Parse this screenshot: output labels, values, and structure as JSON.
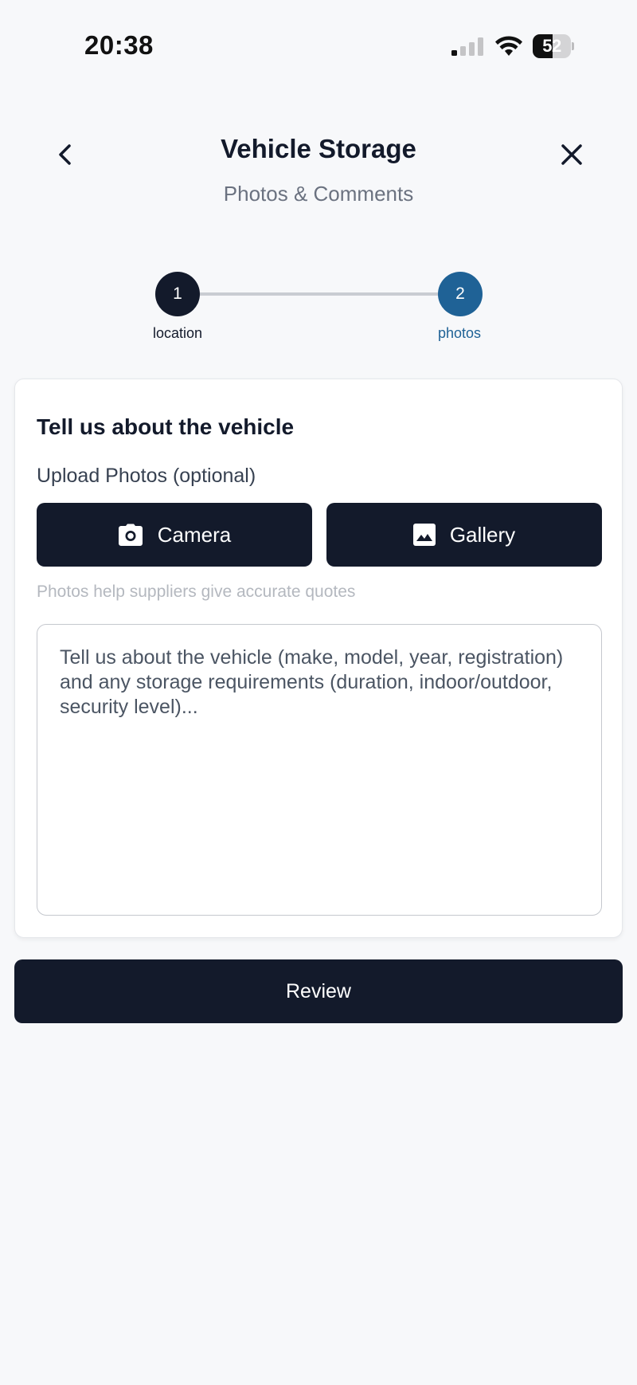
{
  "status_bar": {
    "time": "20:38",
    "battery_level": "52",
    "signal_icon": "signal-bars-icon",
    "wifi_icon": "wifi-icon"
  },
  "header": {
    "title": "Vehicle Storage",
    "subtitle": "Photos & Comments",
    "back_icon": "chevron-left-icon",
    "close_icon": "close-icon"
  },
  "stepper": {
    "steps": [
      {
        "number": "1",
        "label": "location",
        "state": "completed"
      },
      {
        "number": "2",
        "label": "photos",
        "state": "active"
      }
    ]
  },
  "form": {
    "heading": "Tell us about the vehicle",
    "upload_label": "Upload Photos (optional)",
    "camera_label": "Camera",
    "gallery_label": "Gallery",
    "hint": "Photos help suppliers give accurate quotes",
    "comment_placeholder": "Tell us about the vehicle (make, model, year, registration) and any storage requirements (duration, indoor/outdoor, security level)...",
    "comment_value": ""
  },
  "actions": {
    "review_label": "Review"
  },
  "colors": {
    "primary_dark": "#131a2b",
    "active_step": "#1f6296",
    "background": "#f7f8fa"
  }
}
